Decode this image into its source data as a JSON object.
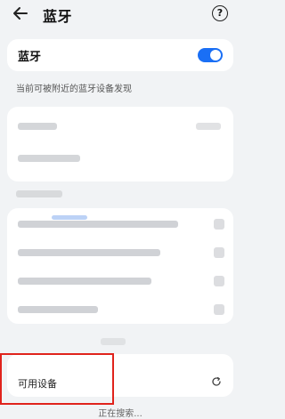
{
  "header": {
    "title": "蓝牙",
    "help_glyph": "?"
  },
  "bluetooth": {
    "label": "蓝牙",
    "enabled": true,
    "toggle_color": "#1a6ff5"
  },
  "visibility_hint": "当前可被附近的蓝牙设备发现",
  "available": {
    "label": "可用设备",
    "status": "正在搜索..."
  },
  "highlight_color": "#e0231c",
  "icons": {
    "back": "back-arrow-icon",
    "help": "help-icon",
    "refresh": "refresh-icon"
  }
}
